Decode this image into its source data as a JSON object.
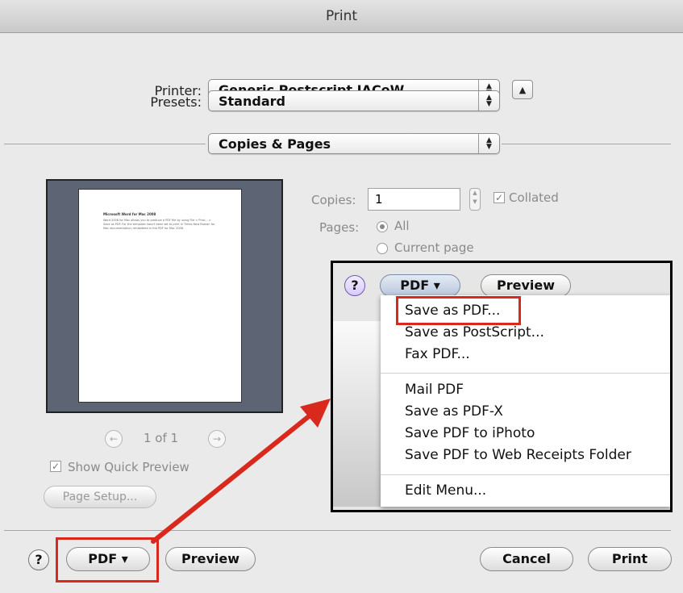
{
  "window": {
    "title": "Print"
  },
  "printer": {
    "label": "Printer:",
    "value": "Generic Postscript JACoW"
  },
  "presets": {
    "label": "Presets:",
    "value": "Standard"
  },
  "section": {
    "value": "Copies & Pages"
  },
  "copies": {
    "label": "Copies:",
    "value": "1",
    "collated_label": "Collated"
  },
  "pages": {
    "label": "Pages:",
    "all_label": "All",
    "current_label": "Current page"
  },
  "preview": {
    "page_indicator": "1 of 1",
    "show_quick_preview_label": "Show Quick Preview",
    "page_setup_label": "Page Setup...",
    "doc_title": "Microsoft Word for Mac 2008",
    "doc_body": "Word 2008 for Mac allows you to produce a PDF file by using File > Print... > Save as PDF. For the template hasn't been set to print in Times New Roman for Mac documentation; embedded in the PDF for Mac 2008."
  },
  "bottom": {
    "help_label": "?",
    "pdf_label": "PDF ▾",
    "preview_label": "Preview",
    "cancel_label": "Cancel",
    "print_label": "Print"
  },
  "popout": {
    "help_label": "?",
    "pdf_label": "PDF ▾",
    "preview_label": "Preview",
    "menu_items": [
      "Save as PDF...",
      "Save as PostScript...",
      "Fax PDF...",
      "Mail PDF",
      "Save as PDF-X",
      "Save PDF to iPhoto",
      "Save PDF to Web Receipts Folder",
      "Edit Menu..."
    ]
  },
  "colors": {
    "highlight": "#d9291c",
    "callout_border": "#000000",
    "preview_bg": "#5d6574"
  }
}
